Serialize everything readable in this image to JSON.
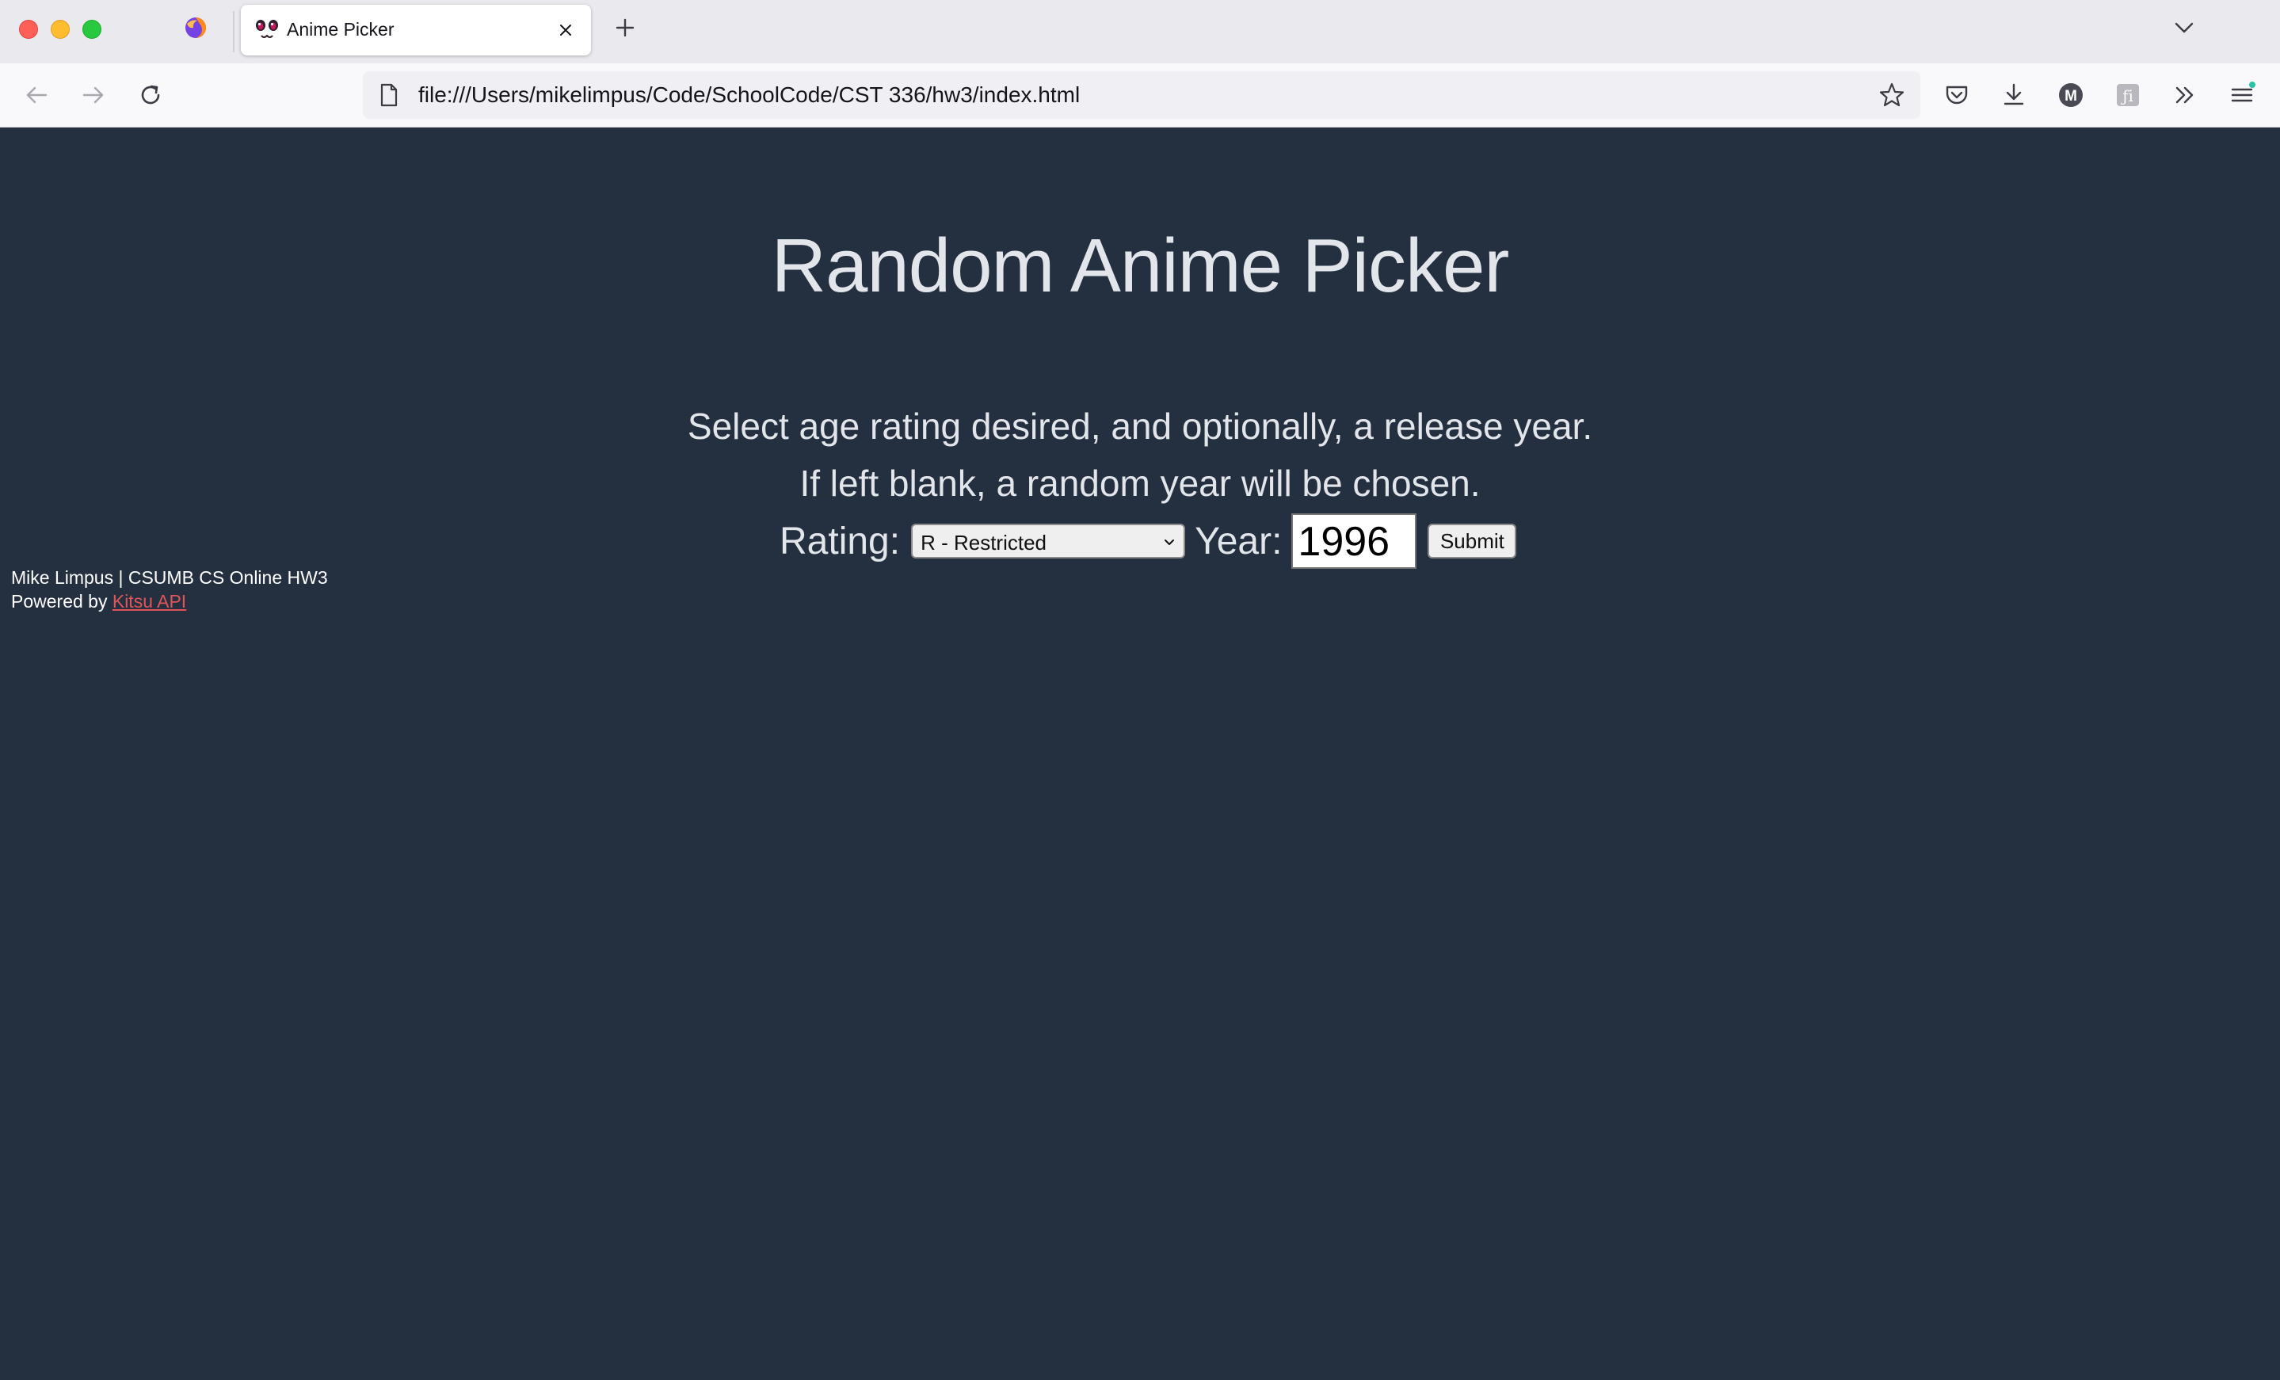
{
  "browser": {
    "active_tab_title": "Anime Picker",
    "url": "file:///Users/mikelimpus/Code/SchoolCode/CST 336/hw3/index.html"
  },
  "page": {
    "title": "Random Anime Picker",
    "instruction_line1": "Select age rating desired, and optionally, a release year.",
    "instruction_line2": "If left blank, a random year will be chosen.",
    "rating_label": "Rating:",
    "rating_selected": "R - Restricted",
    "year_label": "Year:",
    "year_value": "1996",
    "submit_label": "Submit"
  },
  "footer": {
    "credit": "Mike Limpus | CSUMB CS Online HW3",
    "powered_prefix": "Powered by",
    "powered_link": "Kitsu API"
  },
  "colors": {
    "page_background": "#243040",
    "text": "#e2e5ea",
    "link": "#e0555a"
  }
}
